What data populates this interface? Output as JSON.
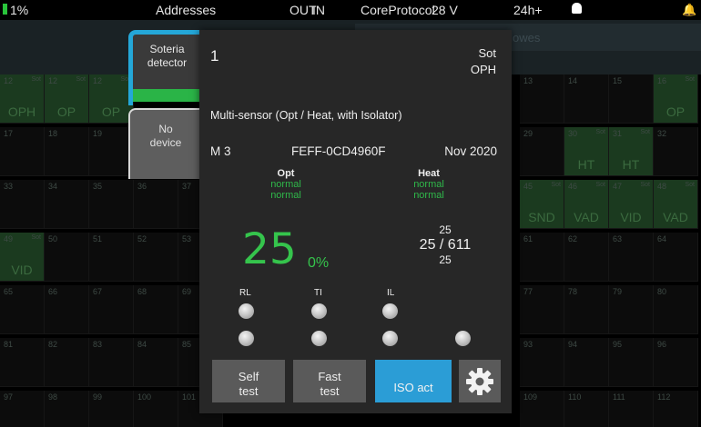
{
  "status_bar": {
    "battery_percent": "1%",
    "addresses": "Addresses",
    "out": "OUT",
    "in": "IN",
    "protocol": "CoreProtocol",
    "voltage": "28 V",
    "hours": "24h+",
    "colors": {
      "battery": "#29c33b",
      "bell": "#e4b72a"
    }
  },
  "background": {
    "header_text": "y lowes",
    "cells": [
      {
        "num": "12",
        "tag": "Sot",
        "label": "OPH",
        "green": true
      },
      {
        "num": "12",
        "tag": "Sot",
        "label": "OP",
        "green": true
      },
      {
        "num": "12",
        "tag": "Sot",
        "label": "OP",
        "green": true
      },
      {
        "num": "13",
        "tag": "",
        "label": "",
        "green": false
      },
      {
        "num": "14",
        "tag": "",
        "label": "",
        "green": false
      },
      {
        "num": "15",
        "tag": "",
        "label": "",
        "green": false
      },
      {
        "num": "16",
        "tag": "Sot",
        "label": "OP",
        "green": true
      },
      {
        "num": "17",
        "tag": "",
        "label": "",
        "green": false
      },
      {
        "num": "18",
        "tag": "",
        "label": "",
        "green": false
      },
      {
        "num": "19",
        "tag": "",
        "label": "",
        "green": false
      },
      {
        "num": "29",
        "tag": "",
        "label": "",
        "green": false
      },
      {
        "num": "30",
        "tag": "Sot",
        "label": "HT",
        "green": true
      },
      {
        "num": "31",
        "tag": "Sot",
        "label": "HT",
        "green": true
      },
      {
        "num": "32",
        "tag": "",
        "label": "",
        "green": false
      },
      {
        "num": "33",
        "tag": "",
        "label": "",
        "green": false
      },
      {
        "num": "34",
        "tag": "",
        "label": "",
        "green": false
      },
      {
        "num": "35",
        "tag": "",
        "label": "",
        "green": false
      },
      {
        "num": "36",
        "tag": "",
        "label": "",
        "green": false
      },
      {
        "num": "37",
        "tag": "",
        "label": "",
        "green": false
      },
      {
        "num": "45",
        "tag": "Sot",
        "label": "SND",
        "green": true
      },
      {
        "num": "46",
        "tag": "Sot",
        "label": "VAD",
        "green": true
      },
      {
        "num": "47",
        "tag": "Sot",
        "label": "VID",
        "green": true
      },
      {
        "num": "48",
        "tag": "Sot",
        "label": "VAD",
        "green": true
      },
      {
        "num": "49",
        "tag": "Sot",
        "label": "VID",
        "green": true
      },
      {
        "num": "50",
        "tag": "",
        "label": "",
        "green": false
      },
      {
        "num": "51",
        "tag": "",
        "label": "",
        "green": false
      },
      {
        "num": "52",
        "tag": "",
        "label": "",
        "green": false
      },
      {
        "num": "53",
        "tag": "",
        "label": "",
        "green": false
      },
      {
        "num": "61",
        "tag": "",
        "label": "",
        "green": false
      },
      {
        "num": "62",
        "tag": "",
        "label": "",
        "green": false
      },
      {
        "num": "63",
        "tag": "",
        "label": "",
        "green": false
      },
      {
        "num": "64",
        "tag": "",
        "label": "",
        "green": false
      },
      {
        "num": "65",
        "tag": "",
        "label": "",
        "green": false
      },
      {
        "num": "66",
        "tag": "",
        "label": "",
        "green": false
      },
      {
        "num": "67",
        "tag": "",
        "label": "",
        "green": false
      },
      {
        "num": "68",
        "tag": "",
        "label": "",
        "green": false
      },
      {
        "num": "69",
        "tag": "",
        "label": "",
        "green": false
      },
      {
        "num": "77",
        "tag": "",
        "label": "",
        "green": false
      },
      {
        "num": "78",
        "tag": "",
        "label": "",
        "green": false
      },
      {
        "num": "79",
        "tag": "",
        "label": "",
        "green": false
      },
      {
        "num": "80",
        "tag": "",
        "label": "",
        "green": false
      },
      {
        "num": "81",
        "tag": "",
        "label": "",
        "green": false
      },
      {
        "num": "82",
        "tag": "",
        "label": "",
        "green": false
      },
      {
        "num": "83",
        "tag": "",
        "label": "",
        "green": false
      },
      {
        "num": "84",
        "tag": "",
        "label": "",
        "green": false
      },
      {
        "num": "85",
        "tag": "",
        "label": "",
        "green": false
      },
      {
        "num": "93",
        "tag": "",
        "label": "",
        "green": false
      },
      {
        "num": "94",
        "tag": "",
        "label": "",
        "green": false
      },
      {
        "num": "95",
        "tag": "",
        "label": "",
        "green": false
      },
      {
        "num": "96",
        "tag": "",
        "label": "",
        "green": false
      },
      {
        "num": "97",
        "tag": "",
        "label": "",
        "green": false
      },
      {
        "num": "98",
        "tag": "",
        "label": "",
        "green": false
      },
      {
        "num": "99",
        "tag": "",
        "label": "",
        "green": false
      },
      {
        "num": "100",
        "tag": "",
        "label": "",
        "green": false
      },
      {
        "num": "101",
        "tag": "",
        "label": "",
        "green": false
      },
      {
        "num": "109",
        "tag": "",
        "label": "",
        "green": false
      },
      {
        "num": "110",
        "tag": "",
        "label": "",
        "green": false
      },
      {
        "num": "111",
        "tag": "",
        "label": "",
        "green": false
      },
      {
        "num": "112",
        "tag": "",
        "label": "",
        "green": false
      }
    ]
  },
  "tabs": {
    "soteria": "Soteria\ndetector",
    "no_device": "No\ndevice",
    "active_color": "#24a7d8"
  },
  "panel": {
    "address": "1",
    "type_line1": "Sot",
    "type_line2": "OPH",
    "description": "Multi-sensor (Opt / Heat, with Isolator)",
    "loop": "M 3",
    "serial": "FEFF-0CD4960F",
    "date": "Nov 2020",
    "opt": {
      "header": "Opt",
      "status1": "normal",
      "status2": "normal"
    },
    "heat": {
      "header": "Heat",
      "status1": "normal",
      "status2": "normal"
    },
    "level_value": "25",
    "level_unit": "0%",
    "ratio_top": "25",
    "ratio_main": "25 / 611",
    "ratio_bottom": "25",
    "led_labels": {
      "rl": "RL",
      "ti": "TI",
      "il": "IL"
    },
    "status_color": "#35c44c"
  },
  "buttons": {
    "self_test": "Self\ntest",
    "fast_test": "Fast\ntest",
    "iso_act": "ISO act",
    "settings_icon": "gear-icon",
    "iso_color": "#2b9dd6"
  }
}
